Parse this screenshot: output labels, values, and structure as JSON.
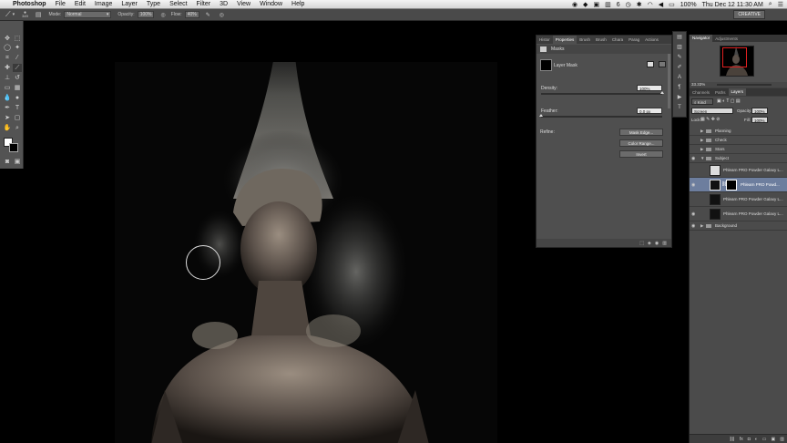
{
  "menubar": {
    "app": "Photoshop",
    "items": [
      "File",
      "Edit",
      "Image",
      "Layer",
      "Type",
      "Select",
      "Filter",
      "3D",
      "View",
      "Window",
      "Help"
    ],
    "status": {
      "num": "6",
      "battery": "100%",
      "clock": "Thu Dec 12  11:30 AM"
    }
  },
  "options": {
    "brush_size": "349",
    "mode_label": "Mode:",
    "mode_value": "Normal",
    "opacity_label": "Opacity:",
    "opacity_value": "100%",
    "flow_label": "Flow:",
    "flow_value": "40%",
    "workspace": "CREATIVE"
  },
  "properties": {
    "tabs": [
      "Histor",
      "Properties",
      "Brush",
      "Brush",
      "Chara",
      "Parag",
      "Actions"
    ],
    "header": "Masks",
    "mask_type": "Layer Mask",
    "density_label": "Density:",
    "density_value": "100%",
    "density_fraction": 1.0,
    "feather_label": "Feather:",
    "feather_value": "0.0 px",
    "feather_fraction": 0.0,
    "refine_label": "Refine:",
    "mask_edge": "Mask Edge...",
    "color_range": "Color Range...",
    "invert": "Invert"
  },
  "navigator": {
    "tabs": [
      "Navigator",
      "Adjustments"
    ],
    "zoom": "33.33%"
  },
  "layers": {
    "tabs": [
      "Channels",
      "Paths",
      "Layers"
    ],
    "kind_label": "Kind",
    "blend_mode": "Screen",
    "opacity_label": "Opacity:",
    "opacity_value": "100%",
    "lock_label": "Lock:",
    "fill_label": "Fill:",
    "fill_value": "100%",
    "rows": [
      {
        "name": "Planning",
        "group": true,
        "visible": false
      },
      {
        "name": "Check",
        "group": true,
        "visible": false
      },
      {
        "name": "Stars",
        "group": true,
        "visible": false
      },
      {
        "name": "Subject",
        "group": true,
        "visible": true,
        "open": true
      },
      {
        "name": "Phlearn PRO Powder Galaxy L...",
        "group": false,
        "visible": false
      },
      {
        "name": "Phlearn PRO Powd...",
        "group": false,
        "visible": true,
        "selected": true,
        "mask": true
      },
      {
        "name": "Phlearn PRO Powder Galaxy L...",
        "group": false,
        "visible": false
      },
      {
        "name": "Phlearn PRO Powder Galaxy L...",
        "group": false,
        "visible": true
      },
      {
        "name": "Background",
        "group": true,
        "visible": true
      }
    ],
    "footer_icons": [
      "link-icon",
      "fx-icon",
      "mask-icon",
      "adjustment-icon",
      "folder-icon",
      "new-layer-icon",
      "trash-icon"
    ]
  }
}
